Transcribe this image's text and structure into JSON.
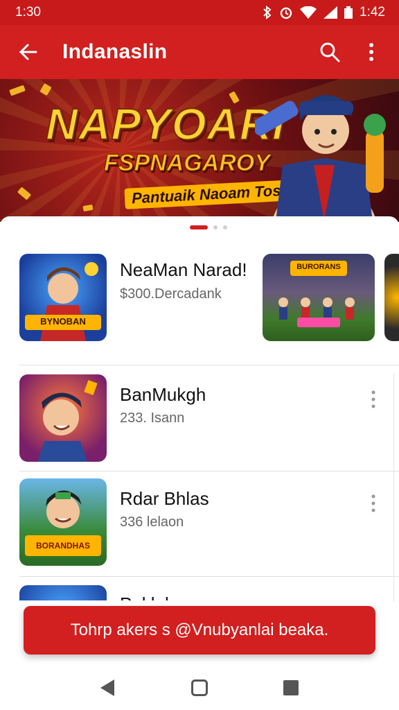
{
  "status_bar": {
    "time_left": "1:30",
    "time_right": "1:42"
  },
  "app_bar": {
    "title": "Indanaslin"
  },
  "banner": {
    "headline": "NAPYOARI",
    "subheadline": "FSPNAGAROY",
    "tagline": "Pantuaik Naoam Tosn!!"
  },
  "carousel": {
    "pages": 3,
    "active_index": 0
  },
  "featured": {
    "title": "NeaMan Narad!",
    "subtitle": "$300.Dercadank",
    "thumb_label": "BYNOBAN",
    "second_thumb_label": "BURORANS"
  },
  "list": [
    {
      "name": "BanMukgh",
      "meta": "233. Isann"
    },
    {
      "name": "Rdar Bhlas",
      "meta": "336 lelaon",
      "thumb_label": "BORANDHAS"
    },
    {
      "name": "Paklal",
      "meta": ""
    }
  ],
  "cta": {
    "label": "Tohrp akers s @Vnubyanlai beaka."
  },
  "colors": {
    "primary": "#d21f1f",
    "status": "#c81a1a"
  }
}
